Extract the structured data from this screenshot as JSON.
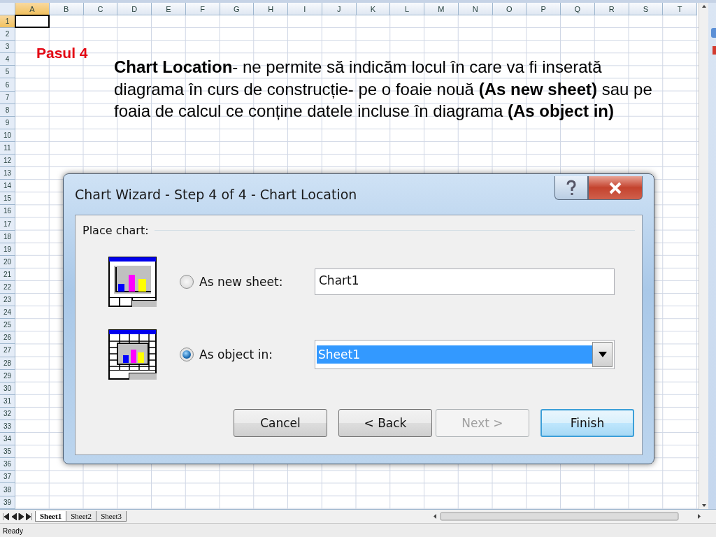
{
  "sheet": {
    "columns": [
      {
        "label": "A",
        "selected": true
      },
      {
        "label": "B",
        "selected": false
      },
      {
        "label": "C",
        "selected": false
      },
      {
        "label": "D",
        "selected": false
      },
      {
        "label": "E",
        "selected": false
      },
      {
        "label": "F",
        "selected": false
      },
      {
        "label": "G",
        "selected": false
      },
      {
        "label": "H",
        "selected": false
      },
      {
        "label": "I",
        "selected": false
      },
      {
        "label": "J",
        "selected": false
      },
      {
        "label": "K",
        "selected": false
      },
      {
        "label": "L",
        "selected": false
      },
      {
        "label": "M",
        "selected": false
      },
      {
        "label": "N",
        "selected": false
      },
      {
        "label": "O",
        "selected": false
      },
      {
        "label": "P",
        "selected": false
      },
      {
        "label": "Q",
        "selected": false
      },
      {
        "label": "R",
        "selected": false
      },
      {
        "label": "S",
        "selected": false
      },
      {
        "label": "T",
        "selected": false
      }
    ],
    "rows": [
      {
        "label": "1",
        "selected": true
      },
      {
        "label": "2",
        "selected": false
      },
      {
        "label": "3",
        "selected": false
      },
      {
        "label": "4",
        "selected": false
      },
      {
        "label": "5",
        "selected": false
      },
      {
        "label": "6",
        "selected": false
      },
      {
        "label": "7",
        "selected": false
      },
      {
        "label": "8",
        "selected": false
      },
      {
        "label": "9",
        "selected": false
      },
      {
        "label": "10",
        "selected": false
      },
      {
        "label": "11",
        "selected": false
      },
      {
        "label": "12",
        "selected": false
      },
      {
        "label": "13",
        "selected": false
      },
      {
        "label": "14",
        "selected": false
      },
      {
        "label": "15",
        "selected": false
      },
      {
        "label": "16",
        "selected": false
      },
      {
        "label": "17",
        "selected": false
      },
      {
        "label": "18",
        "selected": false
      },
      {
        "label": "19",
        "selected": false
      },
      {
        "label": "20",
        "selected": false
      },
      {
        "label": "21",
        "selected": false
      },
      {
        "label": "22",
        "selected": false
      },
      {
        "label": "23",
        "selected": false
      },
      {
        "label": "24",
        "selected": false
      },
      {
        "label": "25",
        "selected": false
      },
      {
        "label": "26",
        "selected": false
      },
      {
        "label": "27",
        "selected": false
      },
      {
        "label": "28",
        "selected": false
      },
      {
        "label": "29",
        "selected": false
      },
      {
        "label": "30",
        "selected": false
      },
      {
        "label": "31",
        "selected": false
      },
      {
        "label": "32",
        "selected": false
      },
      {
        "label": "33",
        "selected": false
      },
      {
        "label": "34",
        "selected": false
      },
      {
        "label": "35",
        "selected": false
      },
      {
        "label": "36",
        "selected": false
      },
      {
        "label": "37",
        "selected": false
      },
      {
        "label": "38",
        "selected": false
      },
      {
        "label": "39",
        "selected": false
      }
    ]
  },
  "slide": {
    "step_label": "Pasul 4",
    "description": "**Chart Location**- ne permite să indicăm locul în care va fi inserată diagrama în curs de construcție- pe o foaie nouă **(As new sheet)** sau pe foaia de calcul ce conține datele incluse în diagrama **(As object in)**"
  },
  "dialog": {
    "title": "Chart Wizard - Step 4 of 4 - Chart Location",
    "group_label": "Place chart:",
    "options": [
      {
        "kind": "text",
        "label": "As new sheet:",
        "selected": false,
        "value": "Chart1"
      },
      {
        "kind": "combo",
        "label": "As object in:",
        "selected": true,
        "value": "Sheet1"
      }
    ],
    "buttons": [
      {
        "label": "Cancel",
        "disabled": false,
        "default": false
      },
      {
        "label": "< Back",
        "disabled": false,
        "default": false
      },
      {
        "label": "Next >",
        "disabled": true,
        "default": false
      },
      {
        "label": "Finish",
        "disabled": false,
        "default": true
      }
    ]
  },
  "sheet_tabs": [
    {
      "label": "Sheet1",
      "selected": true
    },
    {
      "label": "Sheet2",
      "selected": false
    },
    {
      "label": "Sheet3",
      "selected": false
    }
  ],
  "status_bar": {
    "text": "Ready"
  }
}
